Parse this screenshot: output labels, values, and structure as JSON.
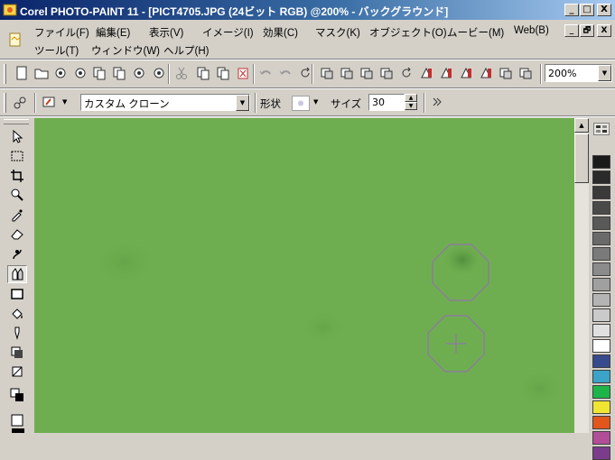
{
  "window": {
    "title": "Corel PHOTO-PAINT 11 - [PICT4705.JPG (24ビット RGB) @200% - バックグラウンド]",
    "buttons": [
      "_",
      "□",
      "X"
    ]
  },
  "menu": {
    "row1": [
      "ファイル(F)",
      "編集(E)",
      "表示(V)",
      "イメージ(I)",
      "効果(C)",
      "マスク(K)",
      "オブジェクト(O)",
      "ムービー(M)",
      "Web(B)"
    ],
    "row2": [
      "ツール(T)",
      "ウィンドウ(W)",
      "ヘルプ(H)"
    ],
    "doc_buttons": [
      "_",
      "🗗",
      "X"
    ]
  },
  "toolbar": {
    "zoom": "200%",
    "icons": [
      "new-icon",
      "open-icon",
      "scan-icon",
      "save-icon",
      "print-icon",
      "paste-icon",
      "import-icon",
      "export-icon",
      "cut-icon",
      "copy-icon",
      "paste-clipboard-icon",
      "delete-icon",
      "undo-icon",
      "redo-icon",
      "repeat-icon",
      "object-icon",
      "clip-icon",
      "lens-icon",
      "mask-icon",
      "rotate-icon",
      "effects-icon",
      "color-icon",
      "channel-icon",
      "histogram-icon",
      "image-icon",
      "grid-icon"
    ]
  },
  "propertybar": {
    "preset": "カスタム クローン",
    "shape_label": "形状",
    "size_label": "サイズ",
    "size_value": "30"
  },
  "tools": [
    "pick-icon",
    "mask-rectangle-icon",
    "crop-icon",
    "zoom-icon",
    "eyedropper-icon",
    "eraser-icon",
    "smear-icon",
    "clone-icon",
    "rectangle-icon",
    "fill-icon",
    "paint-icon",
    "shadow-icon",
    "image-sprayer-icon",
    "color-swap-icon",
    "fg-color-icon"
  ],
  "colors": {
    "accent": "#0a246a",
    "canvas": "#6fae50",
    "palette": [
      "#1a1a1a",
      "#2b2b2b",
      "#3a3a3a",
      "#4a4a4a",
      "#595959",
      "#6a6a6a",
      "#7a7a7a",
      "#8b8b8b",
      "#a0a0a0",
      "#b4b4b4",
      "#cacaca",
      "#e0e0e0",
      "#ffffff",
      "#364a8e",
      "#3aa3c7",
      "#1db54a",
      "#f0e530",
      "#e3561b",
      "#b24e97",
      "#7b3c8c"
    ]
  }
}
